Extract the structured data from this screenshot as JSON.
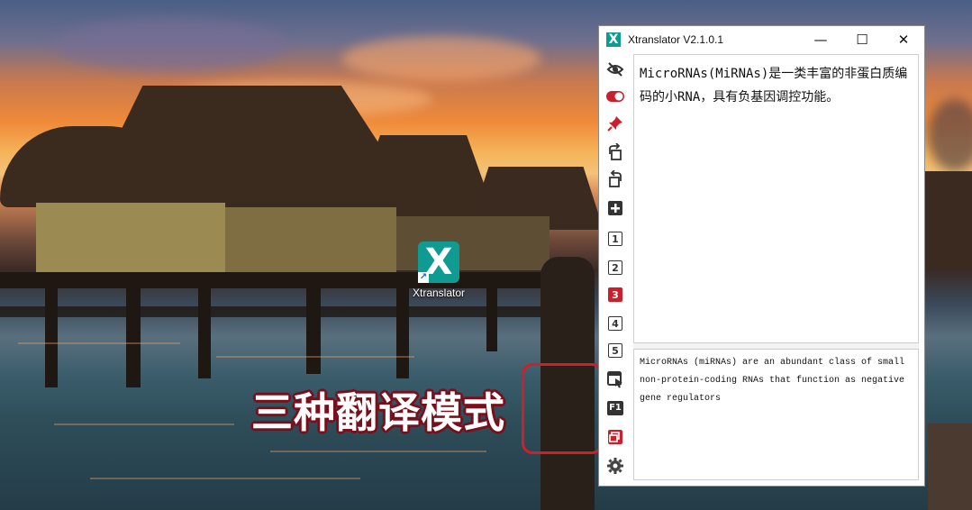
{
  "desktop": {
    "icon_label": "Xtranslator",
    "caption": "三种翻译模式"
  },
  "window": {
    "title": "Xtranslator V2.1.0.1",
    "controls": {
      "minimize": "—",
      "maximize": "☐",
      "close": "✕"
    }
  },
  "toolbar": {
    "icons": [
      "hide-eye-icon",
      "toggle-switch-icon",
      "pin-icon",
      "rotate-right-icon",
      "rotate-left-icon",
      "plus-icon"
    ],
    "modes": [
      "1",
      "2",
      "3",
      "4",
      "5"
    ],
    "active_mode": "3",
    "bottom_icons": [
      "screen-select-icon",
      "f1-icon",
      "copy-window-icon",
      "gear-icon"
    ],
    "f1_label": "F1"
  },
  "source_text": "MicroRNAs(MiRNAs)是一类丰富的非蛋白质编码的小RNA，具有负基因调控功能。",
  "translated_text": "MicroRNAs (miRNAs) are an abundant class of small non-protein-coding RNAs that function as negative gene regulators",
  "colors": {
    "accent": "#c8202c",
    "logo": "#0f9a92"
  }
}
